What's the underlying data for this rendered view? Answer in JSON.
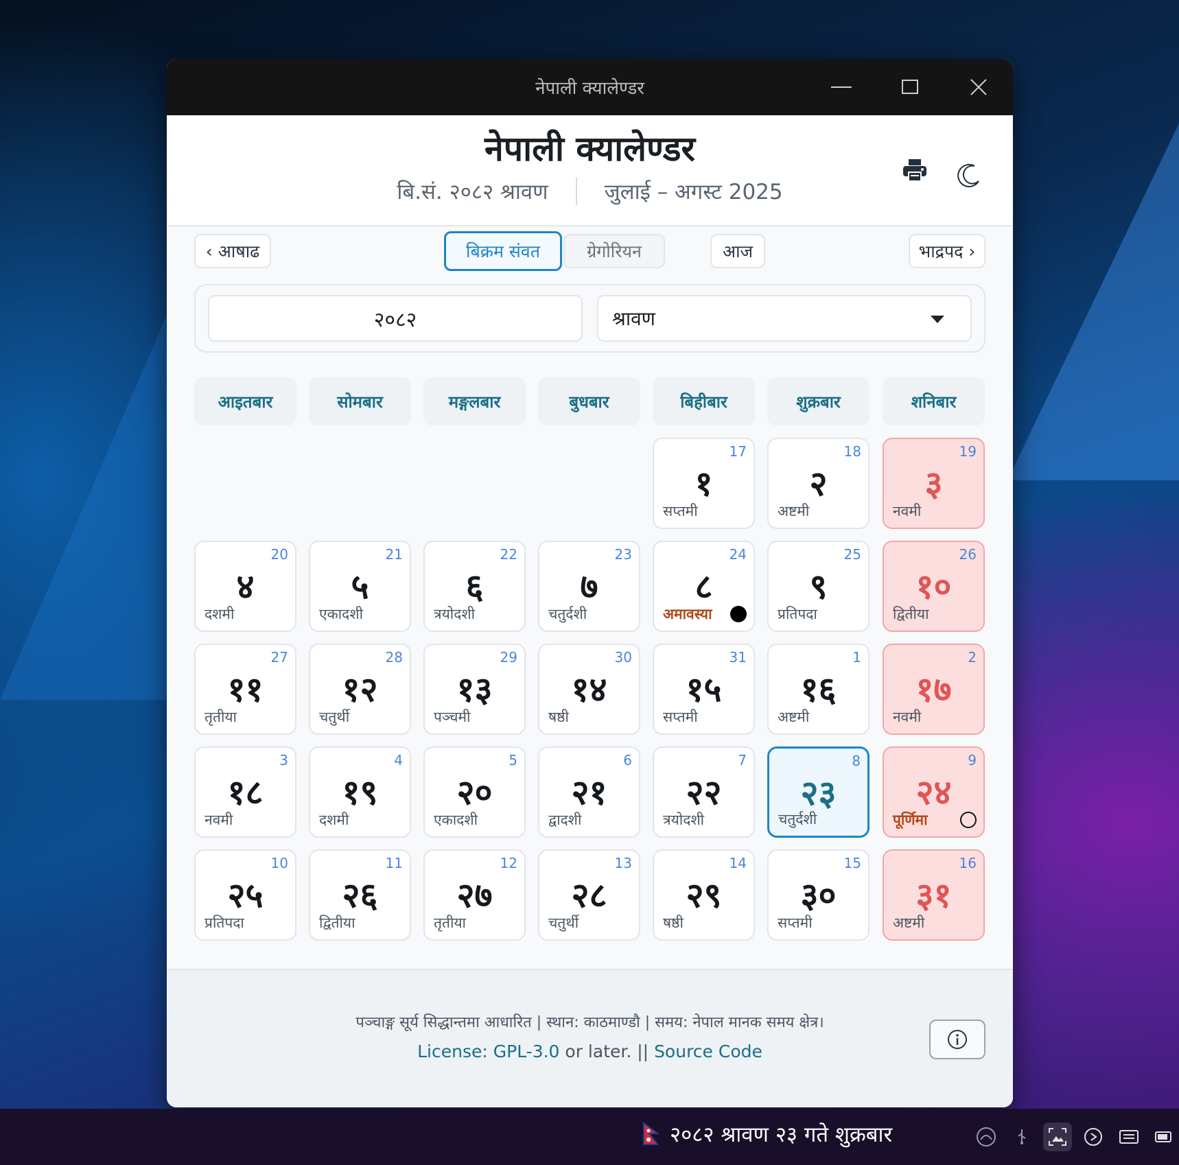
{
  "titlebar": {
    "title": "नेपाली क्यालेण्डर"
  },
  "header": {
    "title": "नेपाली क्यालेण्डर",
    "bs_label": "बि.सं. २०८२ श्रावण",
    "ad_label": "जुलाई – अगस्ट 2025"
  },
  "nav": {
    "prev": "‹ आषाढ",
    "next": "भाद्रपद ›",
    "bs_tab": "बिक्रम संवत",
    "ad_tab": "ग्रेगोरियन",
    "today": "आज"
  },
  "picker": {
    "year": "२०८२",
    "month": "श्रावण"
  },
  "weekdays": [
    "आइतबार",
    "सोमबार",
    "मङ्गलबार",
    "बुधबार",
    "बिहीबार",
    "शुक्रबार",
    "शनिबार"
  ],
  "days": [
    {
      "bs": "१",
      "ad": "17",
      "tithi": "सप्तमी"
    },
    {
      "bs": "२",
      "ad": "18",
      "tithi": "अष्टमी"
    },
    {
      "bs": "३",
      "ad": "19",
      "tithi": "नवमी"
    },
    {
      "bs": "४",
      "ad": "20",
      "tithi": "दशमी"
    },
    {
      "bs": "५",
      "ad": "21",
      "tithi": "एकादशी"
    },
    {
      "bs": "६",
      "ad": "22",
      "tithi": "त्रयोदशी"
    },
    {
      "bs": "७",
      "ad": "23",
      "tithi": "चतुर्दशी"
    },
    {
      "bs": "८",
      "ad": "24",
      "tithi": "अमावस्या",
      "moon": "new"
    },
    {
      "bs": "९",
      "ad": "25",
      "tithi": "प्रतिपदा"
    },
    {
      "bs": "१०",
      "ad": "26",
      "tithi": "द्वितीया"
    },
    {
      "bs": "११",
      "ad": "27",
      "tithi": "तृतीया"
    },
    {
      "bs": "१२",
      "ad": "28",
      "tithi": "चतुर्थी"
    },
    {
      "bs": "१३",
      "ad": "29",
      "tithi": "पञ्चमी"
    },
    {
      "bs": "१४",
      "ad": "30",
      "tithi": "षष्ठी"
    },
    {
      "bs": "१५",
      "ad": "31",
      "tithi": "सप्तमी"
    },
    {
      "bs": "१६",
      "ad": "1",
      "tithi": "अष्टमी"
    },
    {
      "bs": "१७",
      "ad": "2",
      "tithi": "नवमी"
    },
    {
      "bs": "१८",
      "ad": "3",
      "tithi": "नवमी"
    },
    {
      "bs": "१९",
      "ad": "4",
      "tithi": "दशमी"
    },
    {
      "bs": "२०",
      "ad": "5",
      "tithi": "एकादशी"
    },
    {
      "bs": "२१",
      "ad": "6",
      "tithi": "द्वादशी"
    },
    {
      "bs": "२२",
      "ad": "7",
      "tithi": "त्रयोदशी"
    },
    {
      "bs": "२३",
      "ad": "8",
      "tithi": "चतुर्दशी",
      "today": true
    },
    {
      "bs": "२४",
      "ad": "9",
      "tithi": "पूर्णिमा",
      "moon": "full"
    },
    {
      "bs": "२५",
      "ad": "10",
      "tithi": "प्रतिपदा"
    },
    {
      "bs": "२६",
      "ad": "11",
      "tithi": "द्वितीया"
    },
    {
      "bs": "२७",
      "ad": "12",
      "tithi": "तृतीया"
    },
    {
      "bs": "२८",
      "ad": "13",
      "tithi": "चतुर्थी"
    },
    {
      "bs": "२९",
      "ad": "14",
      "tithi": "षष्ठी"
    },
    {
      "bs": "३०",
      "ad": "15",
      "tithi": "सप्तमी"
    },
    {
      "bs": "३१",
      "ad": "16",
      "tithi": "अष्टमी"
    }
  ],
  "footer": {
    "line1": "पञ्चाङ्ग सूर्य सिद्धान्तमा आधारित | स्थान: काठमाण्डौ | समय: नेपाल मानक समय क्षेत्र।",
    "license_link": "License: GPL-3.0",
    "or_later": " or later. || ",
    "source_link": "Source Code"
  },
  "taskbar": {
    "date": "२०८२ श्रावण २३ गते शुक्रबार"
  },
  "colors": {
    "accent": "#1e86c6",
    "saturday_bg": "#fddede",
    "saturday_text": "#e05555",
    "weekday_text": "#1b6f86"
  }
}
